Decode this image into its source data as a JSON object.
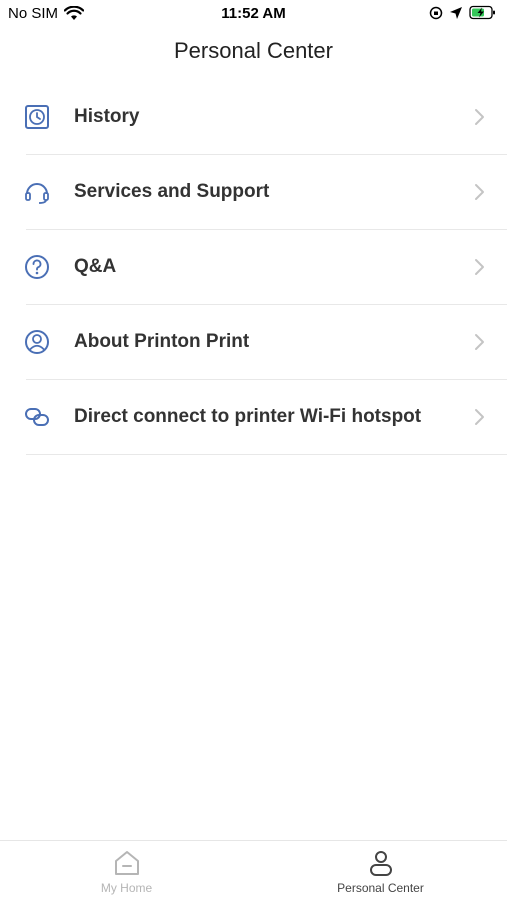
{
  "status_bar": {
    "carrier": "No SIM",
    "time": "11:52 AM"
  },
  "header": {
    "title": "Personal Center"
  },
  "menu": {
    "items": [
      {
        "label": "History",
        "icon": "clock-icon"
      },
      {
        "label": "Services and Support",
        "icon": "headset-icon"
      },
      {
        "label": "Q&A",
        "icon": "question-icon"
      },
      {
        "label": "About Printon Print",
        "icon": "user-circle-icon"
      },
      {
        "label": "Direct connect to printer Wi-Fi hotspot",
        "icon": "link-icon"
      }
    ]
  },
  "tab_bar": {
    "home_label": "My Home",
    "personal_label": "Personal Center"
  },
  "colors": {
    "accent": "#4a6fb5",
    "text": "#333333",
    "muted": "#b5b5b5",
    "divider": "#e8e8e8"
  }
}
